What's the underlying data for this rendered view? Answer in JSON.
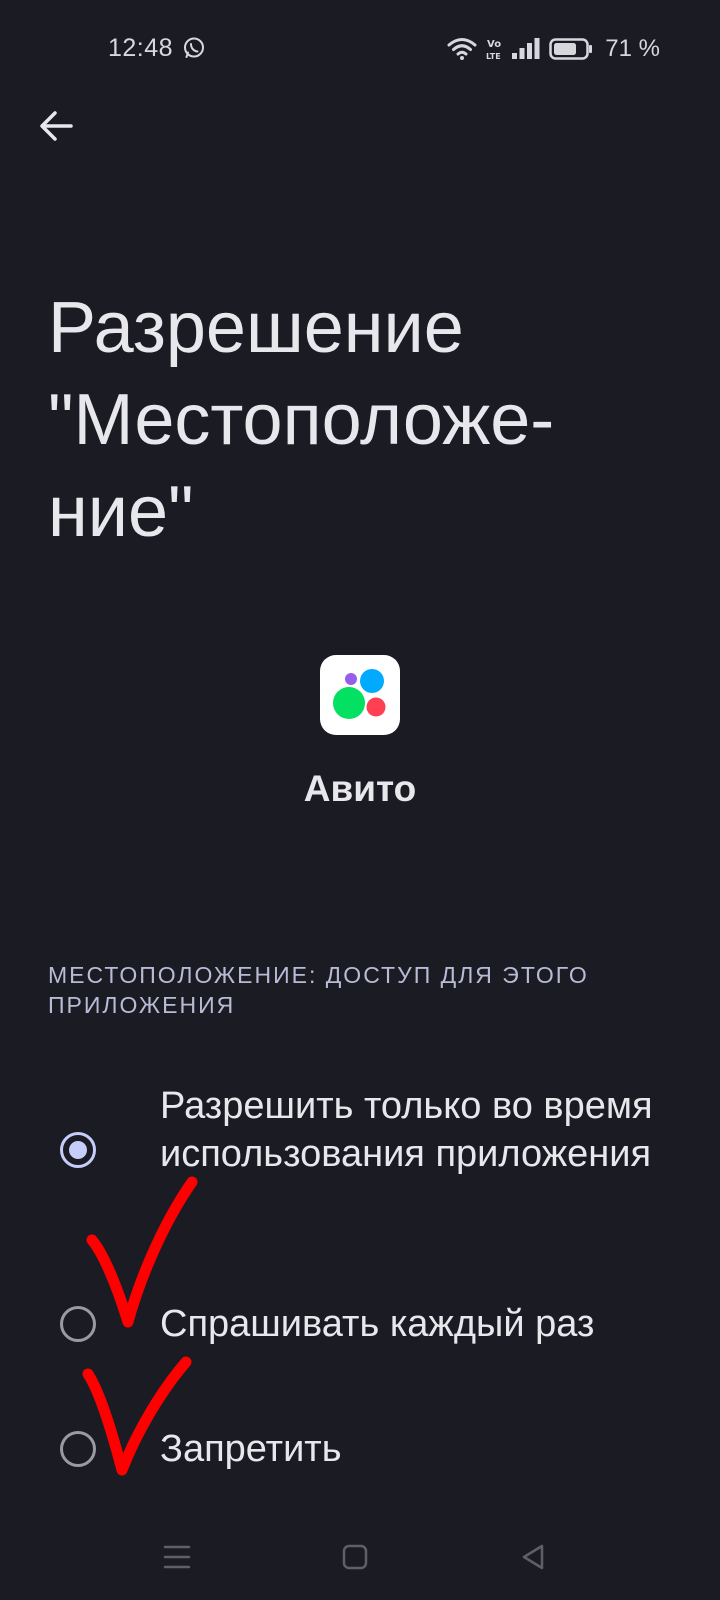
{
  "status_bar": {
    "time": "12:48",
    "battery_percent": "71 %",
    "battery_level": 0.71,
    "icons": [
      "whatsapp-icon",
      "wifi-icon",
      "volte-icon",
      "signal-icon",
      "battery-icon"
    ]
  },
  "header": {
    "back_icon": "arrow-left-icon"
  },
  "title": "Разрешение \"Местоположе-\nние\"",
  "app": {
    "name": "Авито",
    "logo_colors": [
      "#965eeb",
      "#00aaff",
      "#04e061",
      "#ff4053"
    ]
  },
  "section": {
    "label": "Местоположение: доступ для этого приложения"
  },
  "options": [
    {
      "label": "Разрешить только во время использования приложения",
      "selected": true
    },
    {
      "label": "Спрашивать каждый раз",
      "selected": false
    },
    {
      "label": "Запретить",
      "selected": false
    }
  ],
  "nav_bar": {
    "icons": [
      "menu-icon",
      "home-icon",
      "back-triangle-icon"
    ]
  },
  "colors": {
    "background": "#1b1c23",
    "accent": "#c6cdfa",
    "annotation": "#ff0000"
  }
}
